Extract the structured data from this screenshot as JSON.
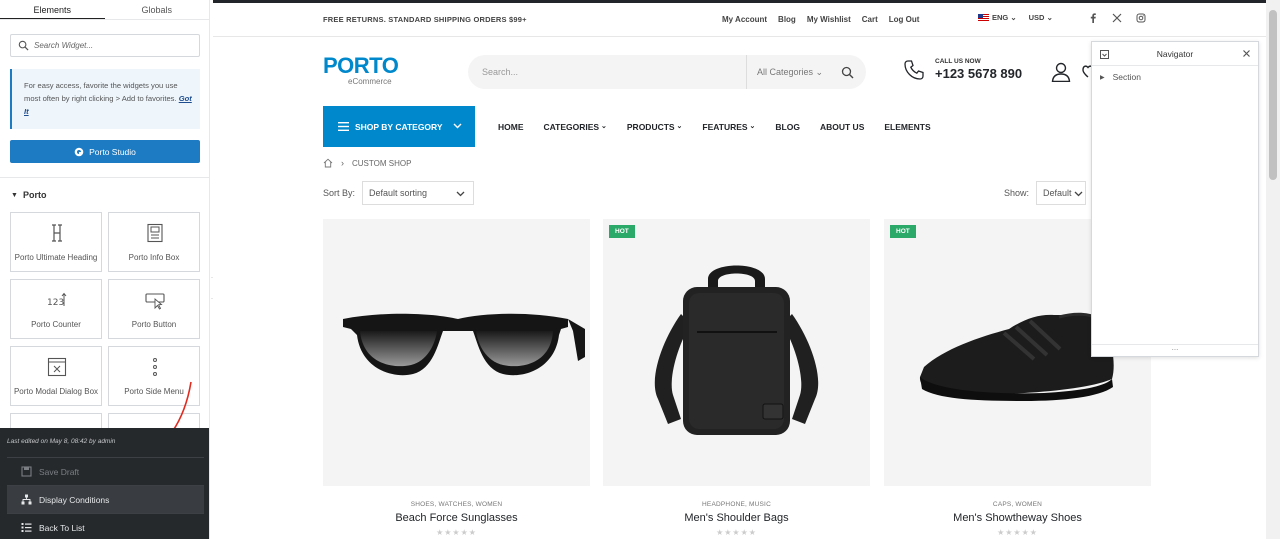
{
  "panel": {
    "tabs": [
      "Elements",
      "Globals"
    ],
    "search_placeholder": "Search Widget...",
    "note_text": "For easy access, favorite the widgets you use most often by right clicking > Add to favorites.",
    "note_link": "Got It",
    "studio_button": "Porto Studio",
    "section_title": "Porto",
    "widgets": [
      {
        "label": "Porto Ultimate Heading",
        "icon": "heading-icon"
      },
      {
        "label": "Porto Info Box",
        "icon": "info-box-icon"
      },
      {
        "label": "Porto Counter",
        "icon": "counter-icon"
      },
      {
        "label": "Porto Button",
        "icon": "button-icon"
      },
      {
        "label": "Porto Modal Dialog Box",
        "icon": "modal-icon"
      },
      {
        "label": "Porto Side Menu",
        "icon": "side-menu-icon"
      }
    ],
    "last_edited": "Last edited on May 8, 08:42 by admin",
    "footer_menu": {
      "save_draft": "Save Draft",
      "display_conditions": "Display Conditions",
      "back_to_list": "Back To List"
    }
  },
  "site": {
    "promo": "FREE RETURNS. STANDARD SHIPPING ORDERS $99+",
    "top_links": [
      "My Account",
      "Blog",
      "My Wishlist",
      "Cart",
      "Log Out"
    ],
    "language": "ENG",
    "currency": "USD",
    "logo": {
      "word": "PORTO",
      "sub": "eCommerce"
    },
    "search_placeholder": "Search...",
    "search_category": "All Categories",
    "call_label": "CALL US NOW",
    "call_number": "+123 5678 890",
    "shop_by_category": "SHOP BY CATEGORY",
    "menu": [
      {
        "label": "HOME",
        "dropdown": false
      },
      {
        "label": "CATEGORIES",
        "dropdown": true
      },
      {
        "label": "PRODUCTS",
        "dropdown": true
      },
      {
        "label": "FEATURES",
        "dropdown": true
      },
      {
        "label": "BLOG",
        "dropdown": false
      },
      {
        "label": "ABOUT US",
        "dropdown": false
      },
      {
        "label": "ELEMENTS",
        "dropdown": false
      }
    ],
    "breadcrumb": "CUSTOM SHOP",
    "sort_label": "Sort By:",
    "sort_value": "Default sorting",
    "show_label": "Show:",
    "show_value": "Default",
    "products": [
      {
        "categories": "SHOES, WATCHES, WOMEN",
        "name": "Beach Force Sunglasses",
        "badge": ""
      },
      {
        "categories": "HEADPHONE, MUSIC",
        "name": "Men's Shoulder Bags",
        "badge": "HOT"
      },
      {
        "categories": "CAPS, WOMEN",
        "name": "Men's Showtheway Shoes",
        "badge": "HOT"
      }
    ],
    "stars": "★★★★★",
    "colors": {
      "brand": "#0088cc",
      "hot": "#2ba968",
      "dark": "#222529"
    }
  },
  "navigator": {
    "title": "Navigator",
    "item": "Section"
  }
}
